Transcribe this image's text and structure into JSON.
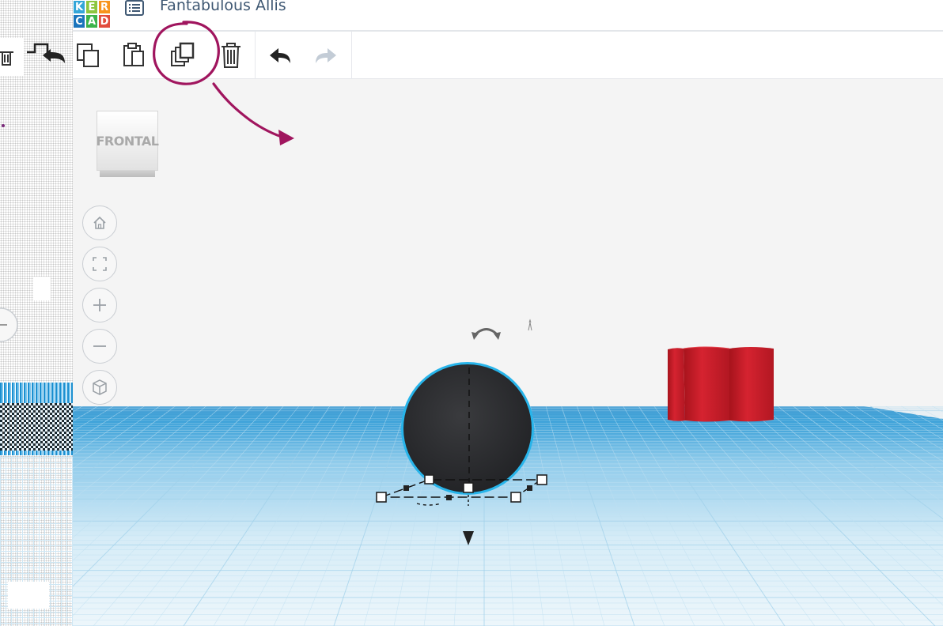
{
  "app": {
    "logo_letters": [
      "K",
      "E",
      "R",
      "C",
      "A",
      "D"
    ],
    "document_title": "Fantabulous Allis"
  },
  "toolbar": {
    "buttons": [
      {
        "name": "copy",
        "icon": "copy-icon",
        "enabled": true
      },
      {
        "name": "paste",
        "icon": "paste-icon",
        "enabled": true
      },
      {
        "name": "duplicate",
        "icon": "duplicate-icon",
        "enabled": true,
        "highlighted": true
      },
      {
        "name": "delete",
        "icon": "trash-icon",
        "enabled": true
      },
      {
        "name": "undo",
        "icon": "undo-icon",
        "enabled": true
      },
      {
        "name": "redo",
        "icon": "redo-icon",
        "enabled": false
      }
    ]
  },
  "viewcube": {
    "face_label": "FRONTAL"
  },
  "nav_controls": [
    {
      "name": "home-view",
      "icon": "home-icon"
    },
    {
      "name": "fit-view",
      "icon": "fit-all-icon"
    },
    {
      "name": "zoom-in",
      "icon": "plus-icon"
    },
    {
      "name": "zoom-out",
      "icon": "minus-icon"
    },
    {
      "name": "perspective",
      "icon": "cube-icon"
    }
  ],
  "scene": {
    "selected_shape": "sphere",
    "shape_colors": {
      "sphere": "#2f3033",
      "selection_outline": "#27b4ea",
      "red_shape": "#c41c28"
    },
    "grid_colors": {
      "horizon": "#1a87c9",
      "grid_line": "#bfe0f1"
    }
  },
  "annotation": {
    "color": "#a0155e",
    "note": "circle around duplicate button with arrow"
  }
}
